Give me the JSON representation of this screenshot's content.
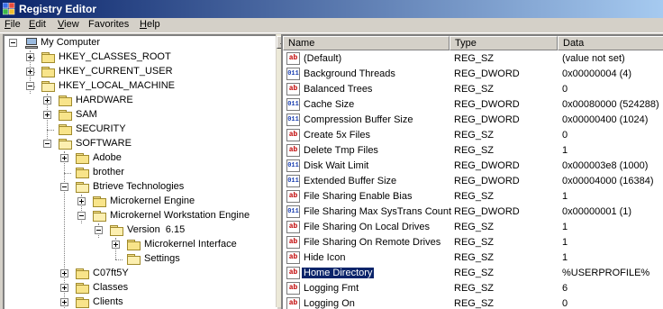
{
  "window": {
    "title": "Registry Editor",
    "app_icon": "registry-editor-icon"
  },
  "menu": [
    {
      "key": "F",
      "rest": "ile"
    },
    {
      "key": "E",
      "rest": "dit"
    },
    {
      "key": "V",
      "rest": "iew"
    },
    {
      "key": "F",
      "rest": "a",
      "tail": "vorites",
      "full": "Favorites"
    },
    {
      "key": "H",
      "rest": "elp"
    }
  ],
  "tree": {
    "root": "My Computer",
    "nodes": [
      {
        "label": "HKEY_CLASSES_ROOT"
      },
      {
        "label": "HKEY_CURRENT_USER"
      },
      {
        "label": "HKEY_LOCAL_MACHINE"
      },
      {
        "label": "HARDWARE"
      },
      {
        "label": "SAM"
      },
      {
        "label": "SECURITY"
      },
      {
        "label": "SOFTWARE"
      },
      {
        "label": "Adobe"
      },
      {
        "label": "brother"
      },
      {
        "label": "Btrieve Technologies"
      },
      {
        "label": "Microkernel Engine"
      },
      {
        "label": "Microkernel Workstation Engine"
      },
      {
        "label": "Version  6.15"
      },
      {
        "label": "Microkernel Interface"
      },
      {
        "label": "Settings"
      },
      {
        "label": "C07ft5Y"
      },
      {
        "label": "Classes"
      },
      {
        "label": "Clients"
      }
    ]
  },
  "list": {
    "headers": {
      "name": "Name",
      "type": "Type",
      "data": "Data"
    },
    "rows": [
      {
        "icon": "string-value-icon",
        "name": "(Default)",
        "type": "REG_SZ",
        "data": "(value not set)"
      },
      {
        "icon": "dword-value-icon",
        "name": "Background Threads",
        "type": "REG_DWORD",
        "data": "0x00000004 (4)"
      },
      {
        "icon": "string-value-icon",
        "name": "Balanced Trees",
        "type": "REG_SZ",
        "data": "0"
      },
      {
        "icon": "dword-value-icon",
        "name": "Cache Size",
        "type": "REG_DWORD",
        "data": "0x00080000 (524288)"
      },
      {
        "icon": "dword-value-icon",
        "name": "Compression Buffer Size",
        "type": "REG_DWORD",
        "data": "0x00000400 (1024)"
      },
      {
        "icon": "string-value-icon",
        "name": "Create 5x Files",
        "type": "REG_SZ",
        "data": "0"
      },
      {
        "icon": "string-value-icon",
        "name": "Delete Tmp Files",
        "type": "REG_SZ",
        "data": "1"
      },
      {
        "icon": "dword-value-icon",
        "name": "Disk Wait Limit",
        "type": "REG_DWORD",
        "data": "0x000003e8 (1000)"
      },
      {
        "icon": "dword-value-icon",
        "name": "Extended Buffer Size",
        "type": "REG_DWORD",
        "data": "0x00004000 (16384)"
      },
      {
        "icon": "string-value-icon",
        "name": "File Sharing Enable Bias",
        "type": "REG_SZ",
        "data": "1"
      },
      {
        "icon": "dword-value-icon",
        "name": "File Sharing Max SysTrans Count",
        "type": "REG_DWORD",
        "data": "0x00000001 (1)"
      },
      {
        "icon": "string-value-icon",
        "name": "File Sharing On Local Drives",
        "type": "REG_SZ",
        "data": "1"
      },
      {
        "icon": "string-value-icon",
        "name": "File Sharing On Remote Drives",
        "type": "REG_SZ",
        "data": "1"
      },
      {
        "icon": "string-value-icon",
        "name": "Hide Icon",
        "type": "REG_SZ",
        "data": "1"
      },
      {
        "icon": "string-value-icon",
        "name": "Home Directory",
        "type": "REG_SZ",
        "data": "%USERPROFILE%",
        "selected": true
      },
      {
        "icon": "string-value-icon",
        "name": "Logging Fmt",
        "type": "REG_SZ",
        "data": "6"
      },
      {
        "icon": "string-value-icon",
        "name": "Logging On",
        "type": "REG_SZ",
        "data": "0"
      }
    ]
  },
  "colors": {
    "title_start": "#0a246a",
    "title_end": "#a6caf0",
    "selection": "#0a246a",
    "string_icon": "#c00000",
    "dword_icon": "#1a3fb0"
  }
}
